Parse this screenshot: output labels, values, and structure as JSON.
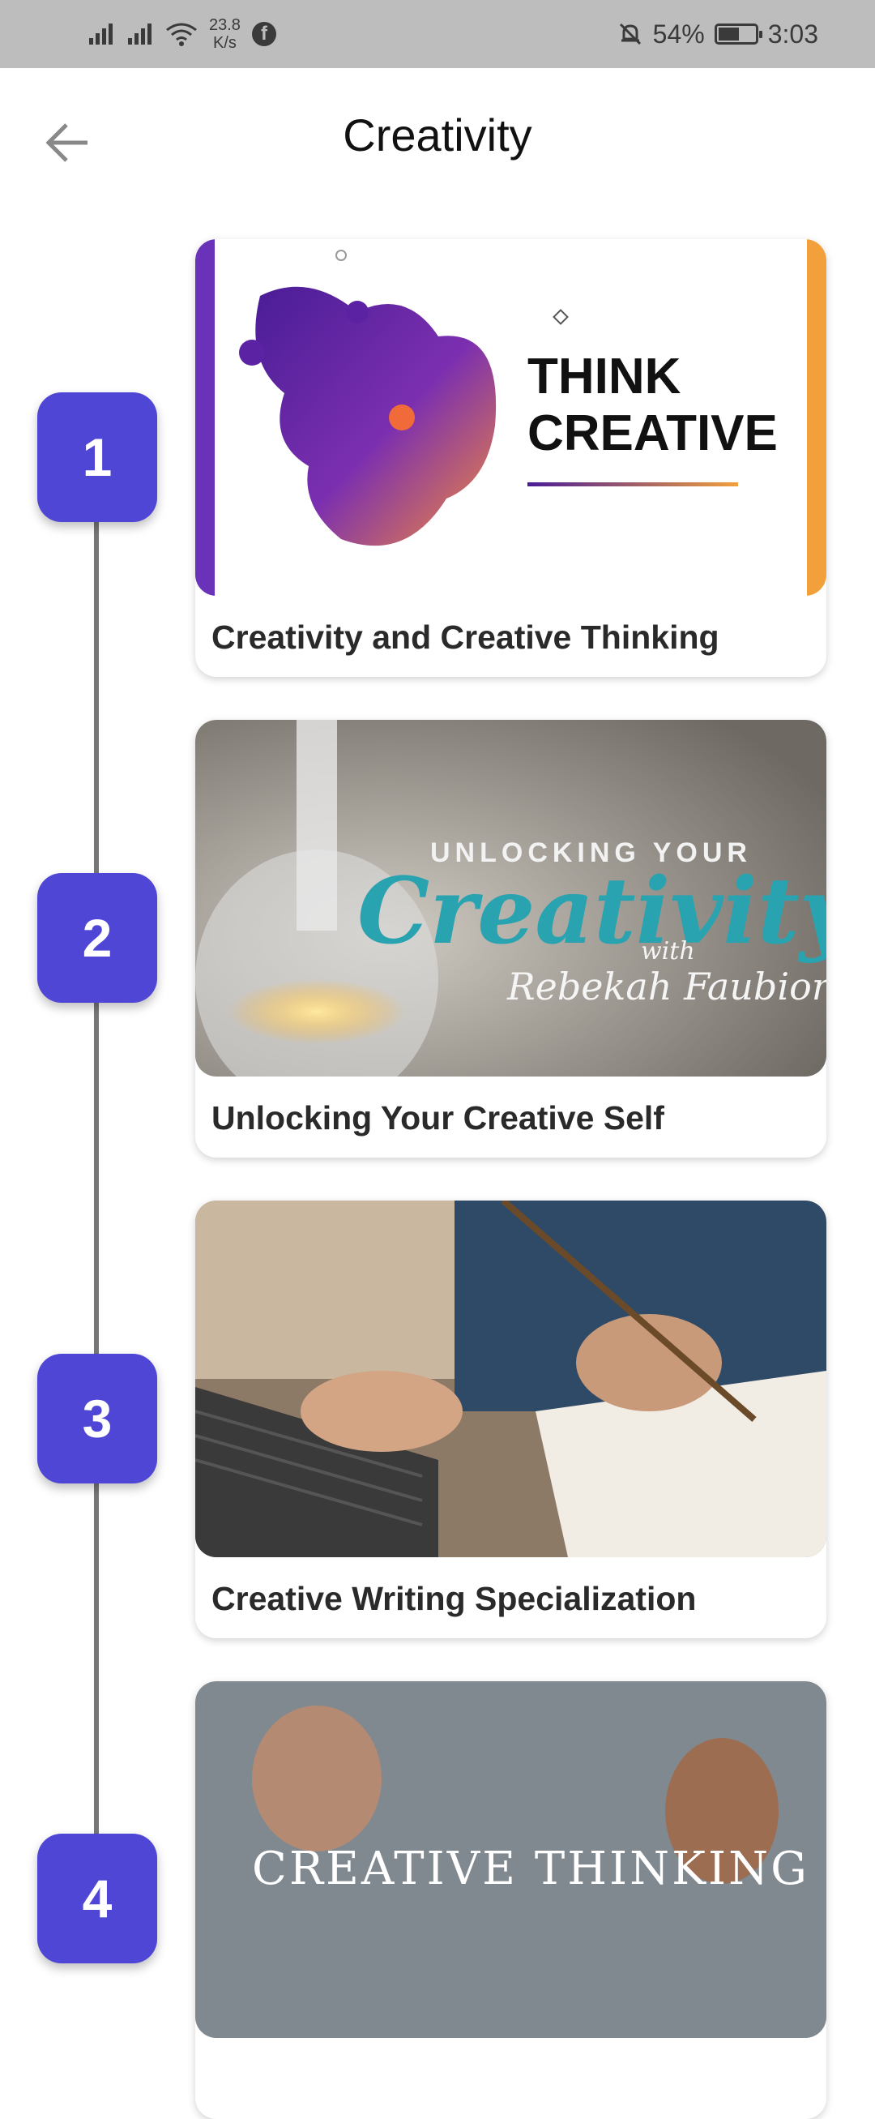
{
  "status_bar": {
    "speed_value": "23.8",
    "speed_unit": "K/s",
    "battery": "54%",
    "time": "3:03"
  },
  "header": {
    "title": "Creativity"
  },
  "courses": [
    {
      "step": "1",
      "title": "Creativity and Creative Thinking",
      "thumb_text_1": "THINK",
      "thumb_text_2": "CREATIVE"
    },
    {
      "step": "2",
      "title": "Unlocking Your Creative Self",
      "thumb_text_1": "UNLOCKING YOUR",
      "thumb_text_2": "Creativity",
      "thumb_text_3": "with",
      "thumb_text_4": "Rebekah Faubion"
    },
    {
      "step": "3",
      "title": "Creative Writing Specialization"
    },
    {
      "step": "4",
      "title": "",
      "thumb_text_1": "CREATIVE THINKING"
    }
  ],
  "colors": {
    "accent": "#4f46d6",
    "status_bar": "#bdbdbd"
  }
}
